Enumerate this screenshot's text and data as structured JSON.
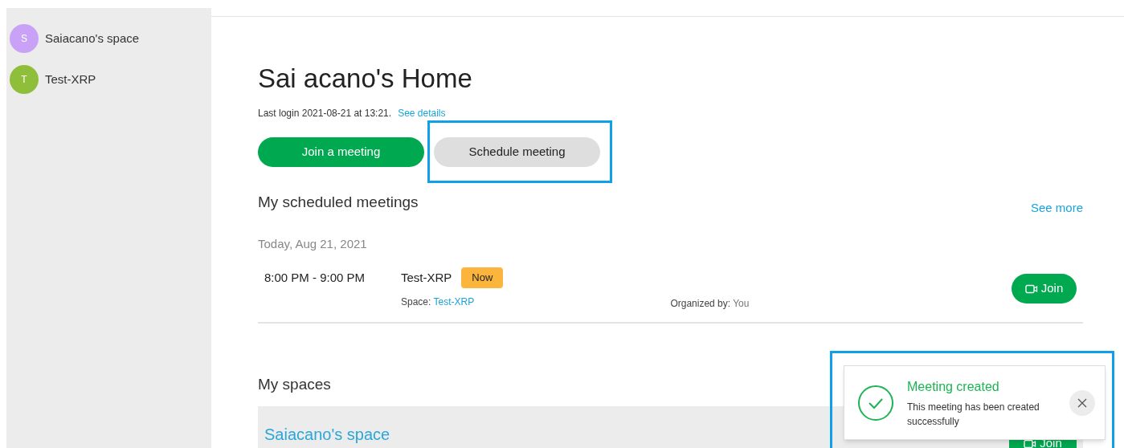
{
  "sidebar": {
    "items": [
      {
        "initial": "S",
        "name": "Saiacano's space",
        "color": "#c9a2f7"
      },
      {
        "initial": "T",
        "name": "Test-XRP",
        "color": "#8fbf3a"
      }
    ]
  },
  "home": {
    "title": "Sai acano's Home",
    "last_login": "Last login 2021-08-21 at 13:21.",
    "see_details": "See details",
    "join_button": "Join a meeting",
    "schedule_button": "Schedule meeting",
    "schedule_highlighted": true
  },
  "scheduled": {
    "heading": "My scheduled meetings",
    "see_more": "See more",
    "date": "Today, Aug 21, 2021",
    "meetings": [
      {
        "time": "8:00 PM - 9:00 PM",
        "title": "Test-XRP",
        "badge": "Now",
        "space_label": "Space:",
        "space": "Test-XRP",
        "organizer_label": "Organized by:",
        "organizer": "You",
        "join": "Join"
      }
    ]
  },
  "spaces": {
    "heading": "My spaces",
    "rows": [
      {
        "name": "Saiacano's space",
        "join": "Join"
      }
    ]
  },
  "toast": {
    "title": "Meeting created",
    "message": "This meeting has been created successfully",
    "highlighted": true
  }
}
